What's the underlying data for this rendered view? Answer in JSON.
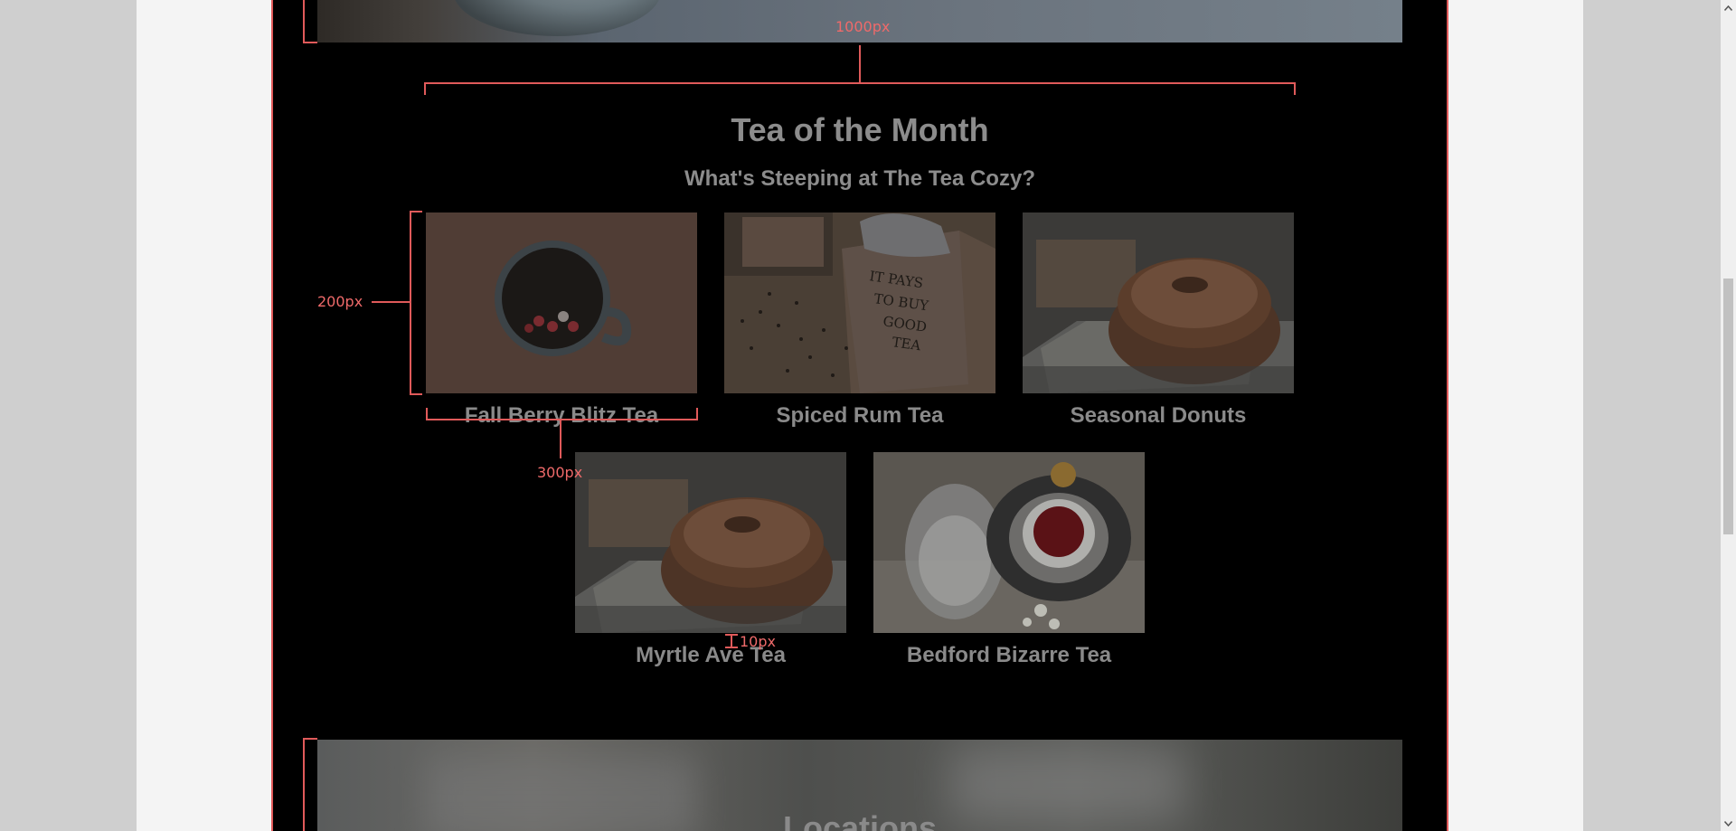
{
  "colors": {
    "page_bg": "#000000",
    "text": "#8c8c8c",
    "guide": "#e05a5a",
    "outer_bg": "#f4f4f4"
  },
  "annotations": {
    "width_label": "1000px",
    "height_label": "200px",
    "item_width_label": "300px",
    "gap_label": "10px"
  },
  "section": {
    "title": "Tea of the Month",
    "subtitle": "What's Steeping at The Tea Cozy?"
  },
  "items": [
    {
      "caption": "Fall Berry Blitz Tea",
      "image": "berry-tea-mug-image"
    },
    {
      "caption": "Spiced Rum Tea",
      "image": "tea-box-image"
    },
    {
      "caption": "Seasonal Donuts",
      "image": "donut-image"
    },
    {
      "caption": "Myrtle Ave Tea",
      "image": "donut-image"
    },
    {
      "caption": "Bedford Bizarre Tea",
      "image": "tea-cup-jar-image"
    }
  ],
  "next_section": {
    "title": "Locations"
  }
}
